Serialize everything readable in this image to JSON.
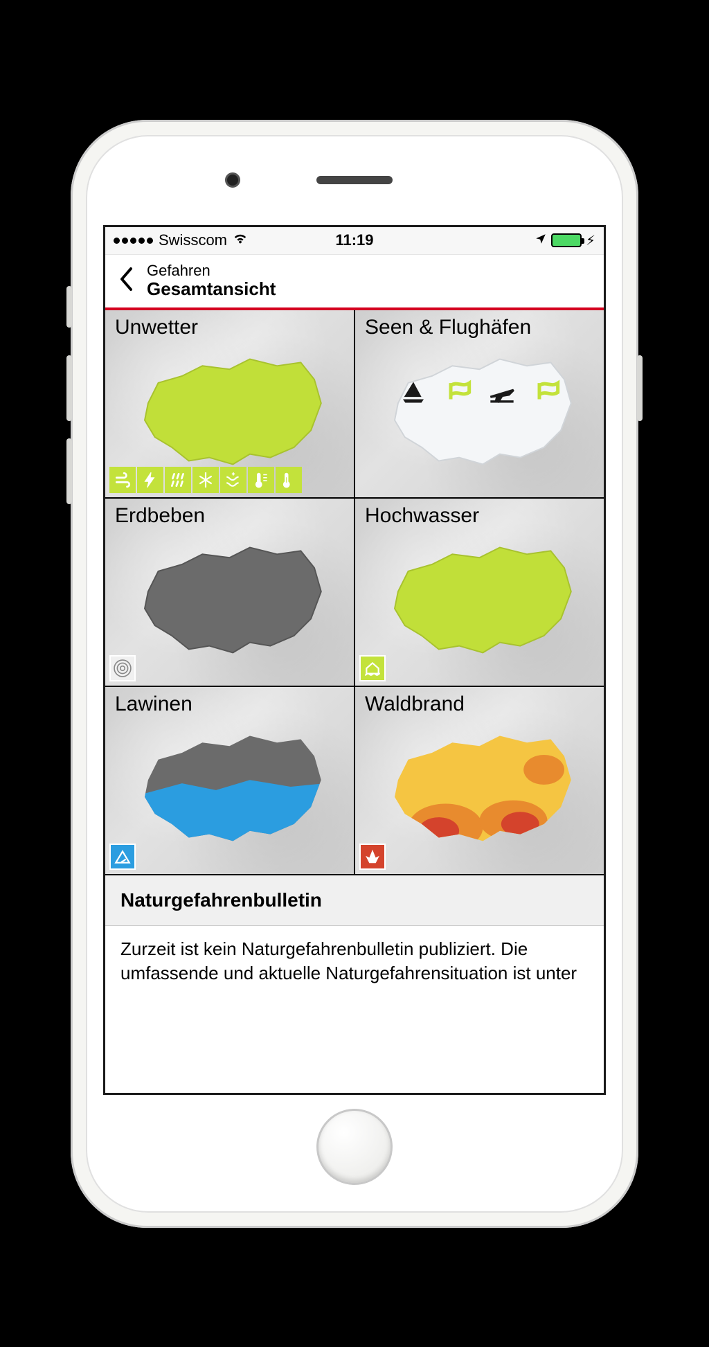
{
  "status_bar": {
    "carrier": "Swisscom",
    "time": "11:19",
    "location_services": true,
    "battery_charging": true
  },
  "nav": {
    "subtitle": "Gefahren",
    "title": "Gesamtansicht"
  },
  "hazards": {
    "unwetter": {
      "label": "Unwetter",
      "map_fill": "#c1df39",
      "sub_icons": [
        "wind",
        "lightning",
        "rain",
        "snow",
        "snowdrift",
        "frost",
        "heat"
      ]
    },
    "seen_flughaefen": {
      "label": "Seen & Flughäfen",
      "map_fill": "#f0f2f4",
      "overlay_icons": [
        "sailboat",
        "wind",
        "plane",
        "wind"
      ]
    },
    "erdbeben": {
      "label": "Erdbeben",
      "map_fill": "#6b6b6b",
      "sub_icons": [
        "seismic"
      ]
    },
    "hochwasser": {
      "label": "Hochwasser",
      "map_fill": "#c1df39",
      "sub_icons": [
        "flood-house"
      ]
    },
    "lawinen": {
      "label": "Lawinen",
      "map_fill_top": "#6b6b6b",
      "map_fill_bottom": "#2b9de0",
      "sub_icons": [
        "avalanche"
      ]
    },
    "waldbrand": {
      "label": "Waldbrand",
      "map_fill": "#f5c542",
      "map_fill_accent": "#e06b2c",
      "sub_icons": [
        "fire"
      ]
    }
  },
  "bulletin": {
    "header": "Naturgefahrenbulletin",
    "body": "Zurzeit ist kein Naturgefahrenbulletin publiziert. Die umfassende und aktuelle Naturgefahrensituation ist unter"
  }
}
